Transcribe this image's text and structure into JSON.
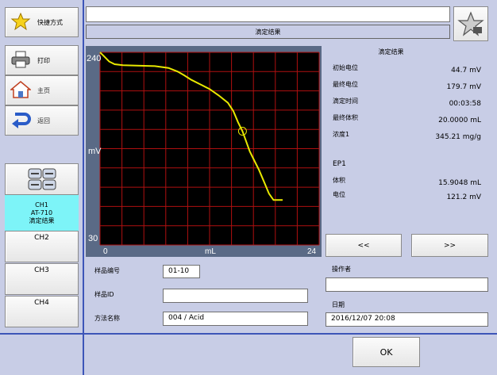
{
  "sidebar": {
    "shortcut_label": "快捷方式",
    "print_label": "打印",
    "home_label": "主页",
    "back_label": "返回",
    "ch1": {
      "title": "CH1",
      "device": "AT-710",
      "status": "滴定结果"
    },
    "ch2": "CH2",
    "ch3": "CH3",
    "ch4": "CH4"
  },
  "header": {
    "title": "滴定结果",
    "top_value": ""
  },
  "chart_data": {
    "type": "line",
    "ylabel": "mV",
    "xlabel": "mL",
    "xlim": [
      0,
      24
    ],
    "ylim": [
      30,
      240
    ],
    "x_tick_labels": [
      "0",
      "24"
    ],
    "y_tick_labels": [
      "240",
      "30"
    ],
    "grid": true,
    "series": [
      {
        "color": "#e8e800",
        "x": [
          0,
          0.4,
          1.0,
          1.6,
          2.5,
          4.0,
          6.0,
          7.5,
          8.5,
          9.2,
          10.0,
          11.0,
          12.0,
          13.0,
          14.0,
          14.6,
          15.1,
          15.6,
          16.0,
          16.4,
          16.9,
          17.4,
          18.0,
          18.5,
          19.0,
          19.6,
          20.0
        ],
        "y": [
          240,
          236,
          230,
          227,
          226,
          225.5,
          225,
          223,
          219,
          215,
          210,
          205,
          200,
          193,
          185,
          176,
          164,
          154,
          143,
          132,
          122,
          112,
          98,
          86,
          79,
          79,
          79
        ]
      }
    ],
    "marker": {
      "x": 15.6,
      "y": 154
    }
  },
  "results": {
    "title": "滴定结果",
    "rows": [
      {
        "label": "初始电位",
        "value": "44.7  mV"
      },
      {
        "label": "最终电位",
        "value": "179.7  mV"
      },
      {
        "label": "滴定时间",
        "value": "00:03:58"
      },
      {
        "label": "最终体积",
        "value": "20.0000  mL"
      },
      {
        "label": "浓度1",
        "value": "345.21  mg/g"
      }
    ],
    "ep_title": "EP1",
    "ep_rows": [
      {
        "label": "体积",
        "value": "15.9048  mL"
      },
      {
        "label": "电位",
        "value": "121.2  mV"
      }
    ],
    "prev_label": "<<",
    "next_label": ">>"
  },
  "sample": {
    "number_label": "样品编号",
    "number_value": "01-10",
    "id_label": "样品ID",
    "id_value": "",
    "method_label": "方法名称",
    "method_value": "004 / Acid"
  },
  "operator": {
    "label": "操作者",
    "value": ""
  },
  "date": {
    "label": "日期",
    "value": "2016/12/07 20:08"
  },
  "ok_label": "OK"
}
